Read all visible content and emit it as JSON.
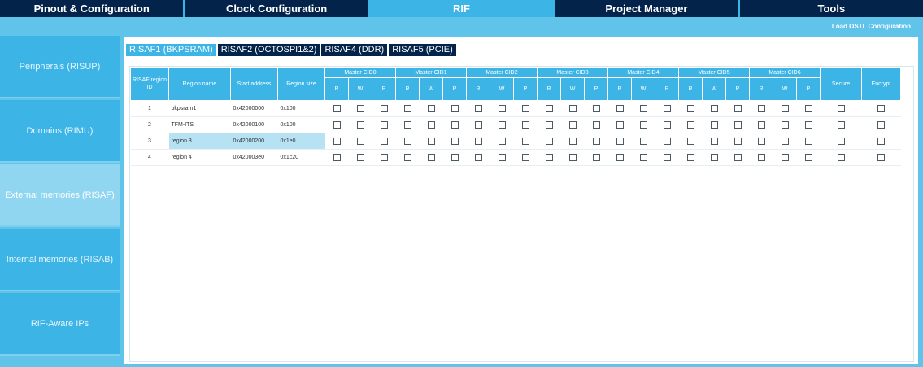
{
  "top_tabs": [
    {
      "label": "Pinout & Configuration"
    },
    {
      "label": "Clock Configuration"
    },
    {
      "label": "RIF"
    },
    {
      "label": "Project Manager"
    },
    {
      "label": "Tools"
    }
  ],
  "active_top_tab": "RIF",
  "load_button": "Load OSTL Configuration",
  "sidebar": {
    "items": [
      {
        "label": "Peripherals (RISUP)"
      },
      {
        "label": "Domains (RIMU)"
      },
      {
        "label": "External memories (RISAF)"
      },
      {
        "label": "Internal memories (RISAB)"
      },
      {
        "label": "RIF-Aware IPs"
      }
    ],
    "active": "External memories (RISAF)"
  },
  "risaf_tabs": [
    {
      "label": "RISAF1 (BKPSRAM)"
    },
    {
      "label": "RISAF2 (OCTOSPI1&2)"
    },
    {
      "label": "RISAF4 (DDR)"
    },
    {
      "label": "RISAF5 (PCIE)"
    }
  ],
  "active_risaf_tab": "RISAF1 (BKPSRAM)",
  "table": {
    "headers": {
      "region_id": "RISAF region ID",
      "region_name": "Region name",
      "start_address": "Start address",
      "region_size": "Region size",
      "secure": "Secure",
      "encrypt": "Encrypt"
    },
    "masters": [
      "Master CID0",
      "Master CID1",
      "Master CID2",
      "Master CID3",
      "Master CID4",
      "Master CID5",
      "Master CID6"
    ],
    "rwp": [
      "R",
      "W",
      "P"
    ],
    "rows": [
      {
        "id": "1",
        "name": "bkpsram1",
        "start": "0x42000000",
        "size": "0x100"
      },
      {
        "id": "2",
        "name": "TFM-ITS",
        "start": "0x42000100",
        "size": "0x100"
      },
      {
        "id": "3",
        "name": "region 3",
        "start": "0x42000200",
        "size": "0x1e0"
      },
      {
        "id": "4",
        "name": "region 4",
        "start": "0x420003e0",
        "size": "0x1c20"
      }
    ],
    "selected_row": "3"
  }
}
